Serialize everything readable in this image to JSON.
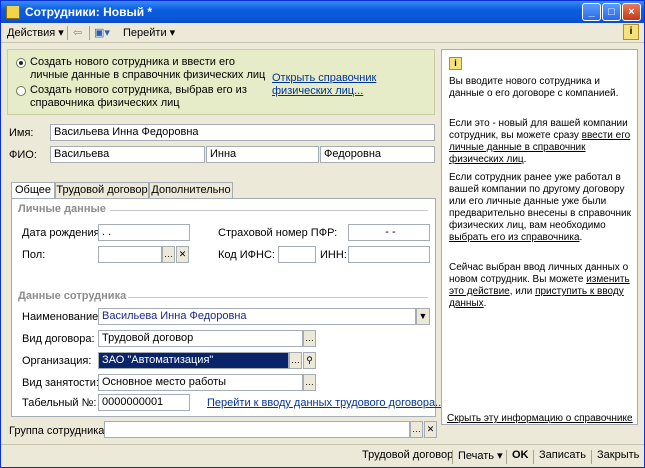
{
  "window": {
    "title": "Сотрудники: Новый *",
    "min": "_",
    "max": "□",
    "close": "×"
  },
  "toolbar": {
    "actions": "Действия ▾",
    "go": "Перейти ▾"
  },
  "choice": {
    "option1": "Создать нового сотрудника и ввести его личные данные в справочник физических лиц",
    "option2": "Создать нового сотрудника, выбрав его из справочника физических лиц",
    "link": "Открыть справочник физических лиц..."
  },
  "name": {
    "label": "Имя:",
    "value": "Васильева Инна Федоровна"
  },
  "fio": {
    "label": "ФИО:",
    "last": "Васильева",
    "first": "Инна",
    "middle": "Федоровна"
  },
  "tabs": [
    "Общее",
    "Трудовой договор",
    "Дополнительно"
  ],
  "personal": {
    "header": "Личные данные",
    "dob_label": "Дата рождения:",
    "dob_value": " .  .",
    "pfr_label": "Страховой номер ПФР:",
    "pfr_value": "-   -",
    "sex_label": "Пол:",
    "ifns_label": "Код ИФНС:",
    "inn_label": "ИНН:"
  },
  "employee": {
    "header": "Данные сотрудника",
    "name_label": "Наименование:",
    "name_value": "Васильева Инна Федоровна",
    "contract_label": "Вид договора:",
    "contract_value": "Трудовой договор",
    "org_label": "Организация:",
    "org_value": "ЗАО \"Автоматизация\"",
    "employment_label": "Вид занятости:",
    "employment_value": "Основное место работы",
    "tabnum_label": "Табельный №:",
    "tabnum_value": "0000000001",
    "contract_link": "Перейти к вводу данных трудового договора..."
  },
  "group": {
    "label": "Группа сотрудника:",
    "value": ""
  },
  "info": {
    "p1": "Вы вводите нового сотрудника и данные о его договоре с компанией.",
    "p2a": "Если это - новый для вашей компании сотрудник, вы можете сразу ",
    "p2b": "ввести его личные данные в справочник физических лиц",
    "p3a": "Если сотрудник ранее уже работал в вашей компании по другому договору или его личные данные уже были предварительно внесены в справочник физических лиц, вам необходимо ",
    "p3b": "выбрать его из справочника",
    "p4a": "Сейчас выбран ввод личных данных о новом сотрудник. Вы можете ",
    "p4b": "изменить это действие",
    "p4c": ", или ",
    "p4d": "приступить к вводу данных",
    "hide_link": "Скрыть эту информацию о справочнике"
  },
  "bottom": {
    "contract": "Трудовой договор",
    "print": "Печать ▾",
    "ok": "OK",
    "save": "Записать",
    "close": "Закрыть"
  }
}
